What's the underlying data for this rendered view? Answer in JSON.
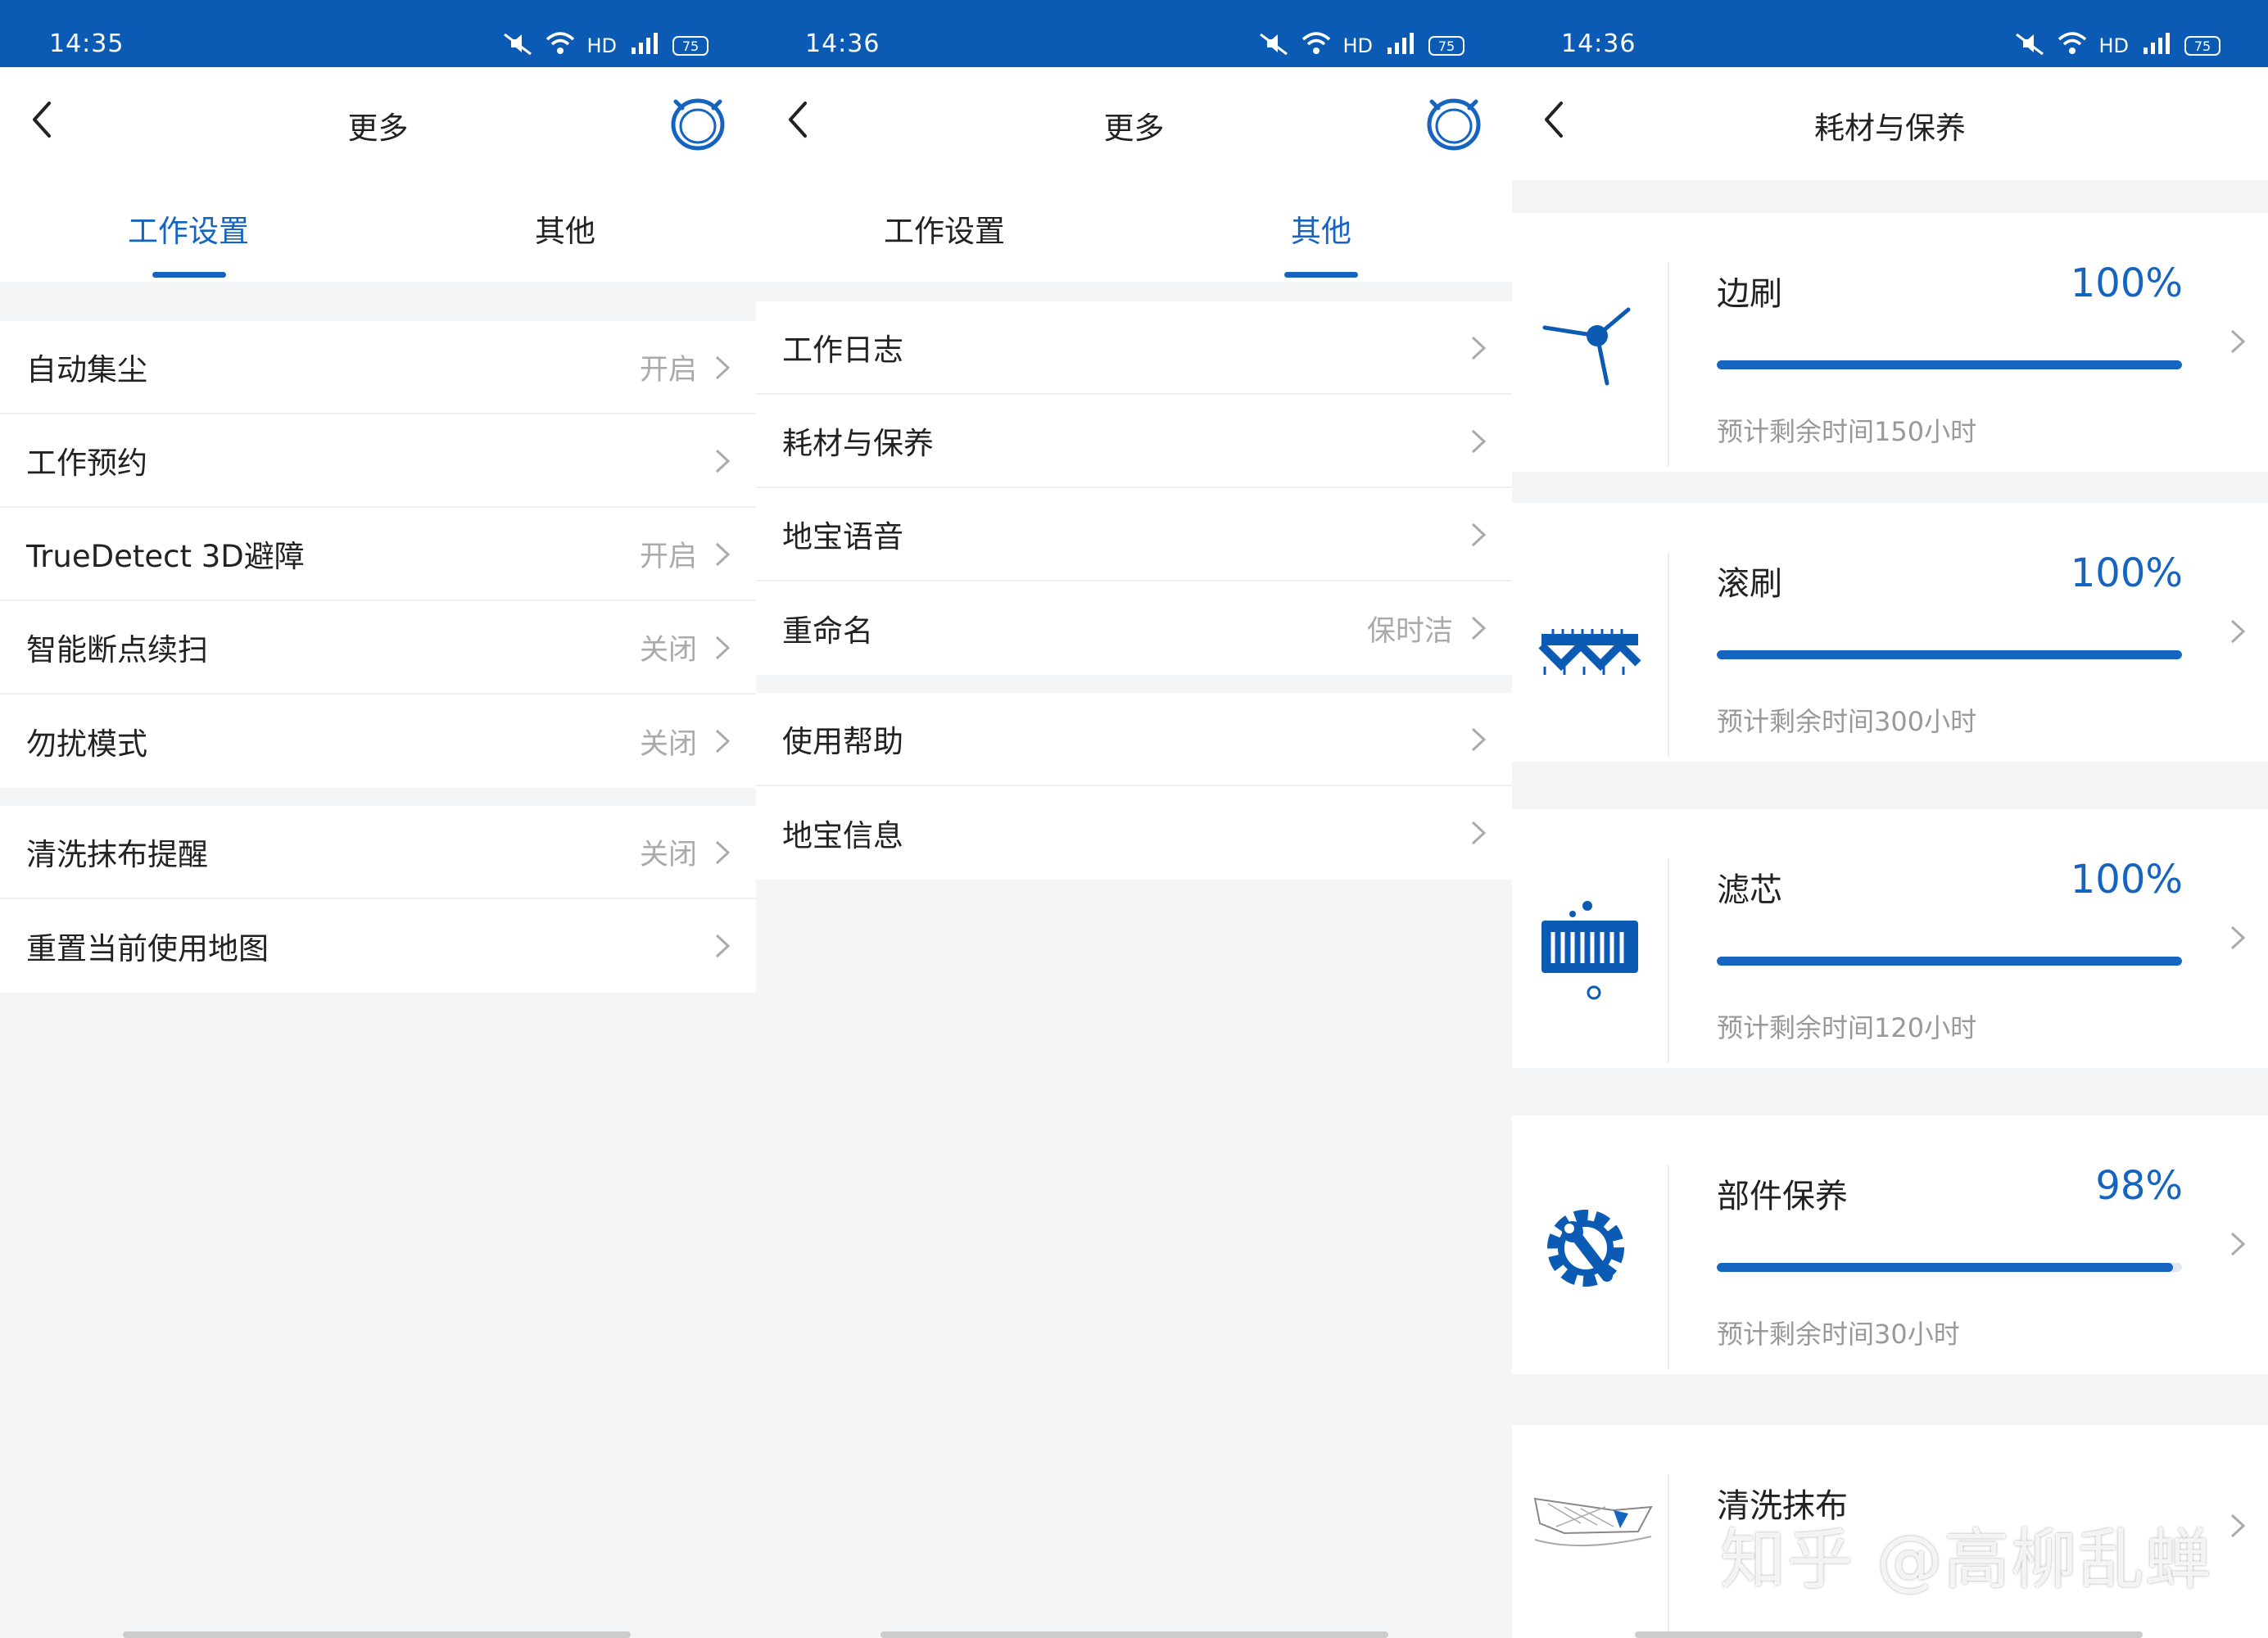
{
  "screens": [
    {
      "status": {
        "time": "14:35",
        "network": "HD",
        "signal": "4G",
        "battery": "75"
      },
      "header": {
        "title": "更多"
      },
      "tabs": [
        {
          "label": "工作设置",
          "active": true
        },
        {
          "label": "其他",
          "active": false
        }
      ],
      "groups": [
        [
          {
            "label": "自动集尘",
            "value": "开启"
          },
          {
            "label": "工作预约",
            "value": ""
          },
          {
            "label": "TrueDetect 3D避障",
            "value": "开启"
          },
          {
            "label": "智能断点续扫",
            "value": "关闭"
          },
          {
            "label": "勿扰模式",
            "value": "关闭"
          }
        ],
        [
          {
            "label": "清洗抹布提醒",
            "value": "关闭"
          },
          {
            "label": "重置当前使用地图",
            "value": ""
          }
        ]
      ]
    },
    {
      "status": {
        "time": "14:36",
        "network": "HD",
        "signal": "4G",
        "battery": "75"
      },
      "header": {
        "title": "更多"
      },
      "tabs": [
        {
          "label": "工作设置",
          "active": false
        },
        {
          "label": "其他",
          "active": true
        }
      ],
      "groups": [
        [
          {
            "label": "工作日志",
            "value": ""
          },
          {
            "label": "耗材与保养",
            "value": ""
          },
          {
            "label": "地宝语音",
            "value": ""
          },
          {
            "label": "重命名",
            "value": "保时洁"
          }
        ],
        [
          {
            "label": "使用帮助",
            "value": ""
          },
          {
            "label": "地宝信息",
            "value": ""
          }
        ]
      ]
    },
    {
      "status": {
        "time": "14:36",
        "network": "HD",
        "signal": "4G",
        "battery": "75"
      },
      "header": {
        "title": "耗材与保养"
      },
      "consumables": [
        {
          "name": "边刷",
          "percent": "100%",
          "level": 100,
          "remaining": "预计剩余时间150小时",
          "icon": "side-brush-icon"
        },
        {
          "name": "滚刷",
          "percent": "100%",
          "level": 100,
          "remaining": "预计剩余时间300小时",
          "icon": "roller-brush-icon"
        },
        {
          "name": "滤芯",
          "percent": "100%",
          "level": 100,
          "remaining": "预计剩余时间120小时",
          "icon": "filter-icon"
        },
        {
          "name": "部件保养",
          "percent": "98%",
          "level": 98,
          "remaining": "预计剩余时间30小时",
          "icon": "maintenance-gear-icon"
        },
        {
          "name": "清洗抹布",
          "percent": "",
          "level": null,
          "remaining": "",
          "icon": "mop-cloth-icon"
        }
      ]
    }
  ],
  "watermark": "知乎 @高柳乱蝉",
  "colors": {
    "status_bar": "#0b5bb5",
    "accent": "#1565c0",
    "bg": "#f4f5f7"
  }
}
